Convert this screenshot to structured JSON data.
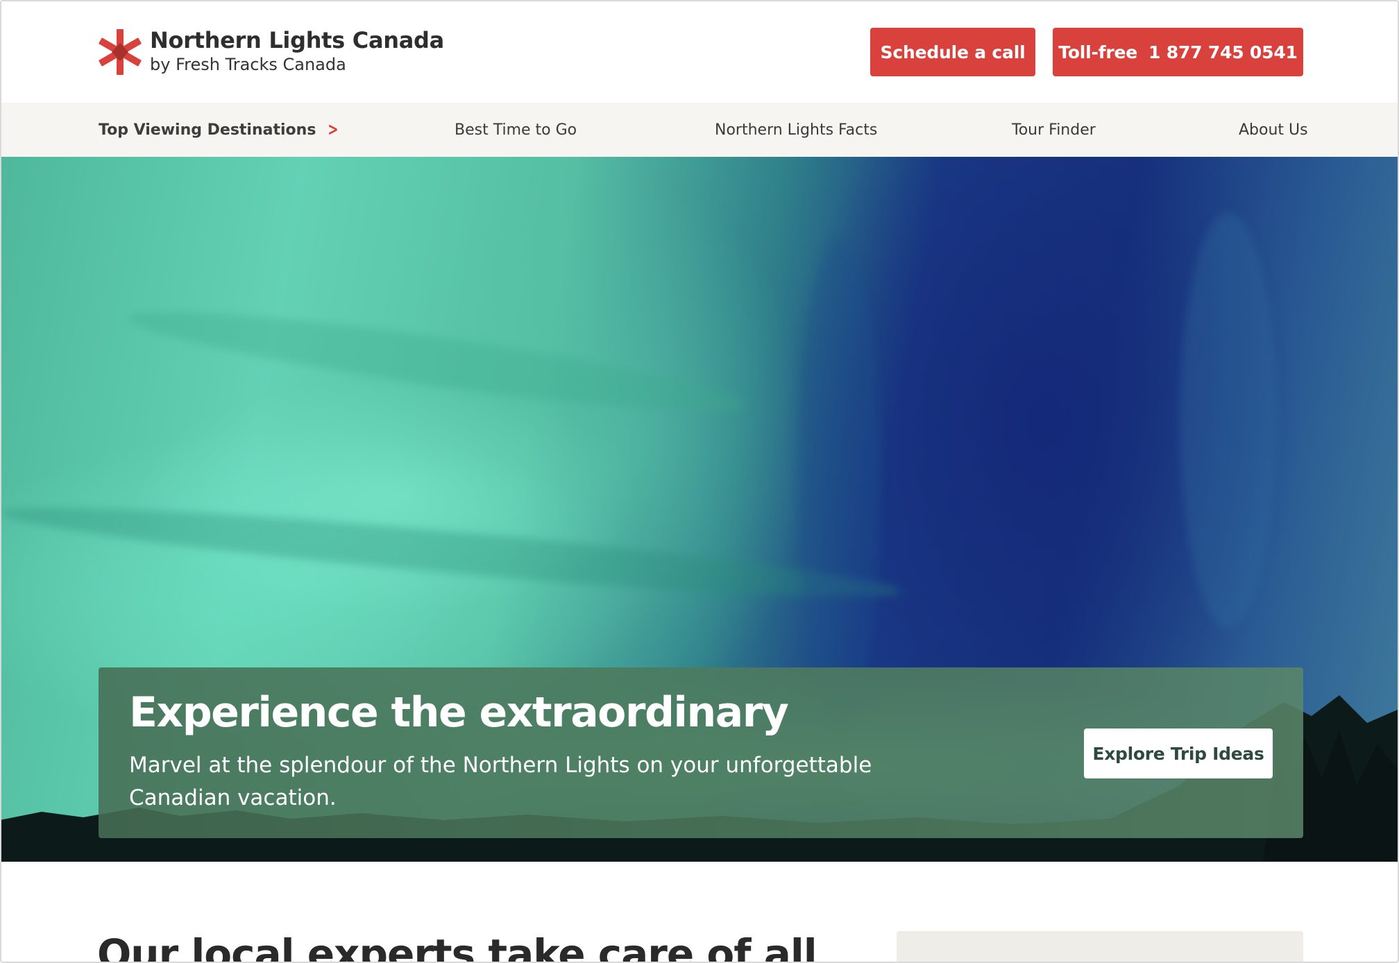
{
  "header": {
    "logo_title": "Northern Lights Canada",
    "logo_subtitle": "by Fresh Tracks Canada",
    "schedule_label": "Schedule a call",
    "tollfree_label": "Toll-free",
    "tollfree_number": "1 877 745 0541"
  },
  "nav": {
    "items": [
      {
        "label": "Top Viewing Destinations",
        "icon": "chevron-right-icon"
      },
      {
        "label": "Best Time to Go"
      },
      {
        "label": "Northern Lights Facts"
      },
      {
        "label": "Tour Finder"
      },
      {
        "label": "About Us"
      }
    ]
  },
  "hero": {
    "title": "Experience the extraordinary",
    "text": "Marvel at the splendour of the Northern Lights on your unforgettable Canadian vacation.",
    "cta_label": "Explore Trip Ideas"
  },
  "section": {
    "heading": "Our local experts take care of all"
  },
  "colors": {
    "accent": "#d9423c",
    "nav_bg": "#f6f5f1"
  }
}
